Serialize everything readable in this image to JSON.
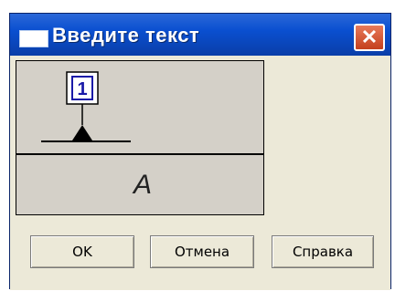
{
  "window": {
    "title": "Введите текст",
    "close_label": "✕"
  },
  "preview": {
    "number_symbol": "1",
    "letter": "A"
  },
  "buttons": {
    "ok": "OK",
    "cancel": "Отмена",
    "help": "Справка"
  },
  "colors": {
    "titlebar": "#0a4fd0",
    "close": "#d4502e",
    "dialog_bg": "#ece9d8",
    "panel_bg": "#d4d0c8",
    "symbol_fill": "#1a1aa8"
  },
  "icons": {
    "window_icon": "window-icon",
    "close": "close-icon"
  }
}
